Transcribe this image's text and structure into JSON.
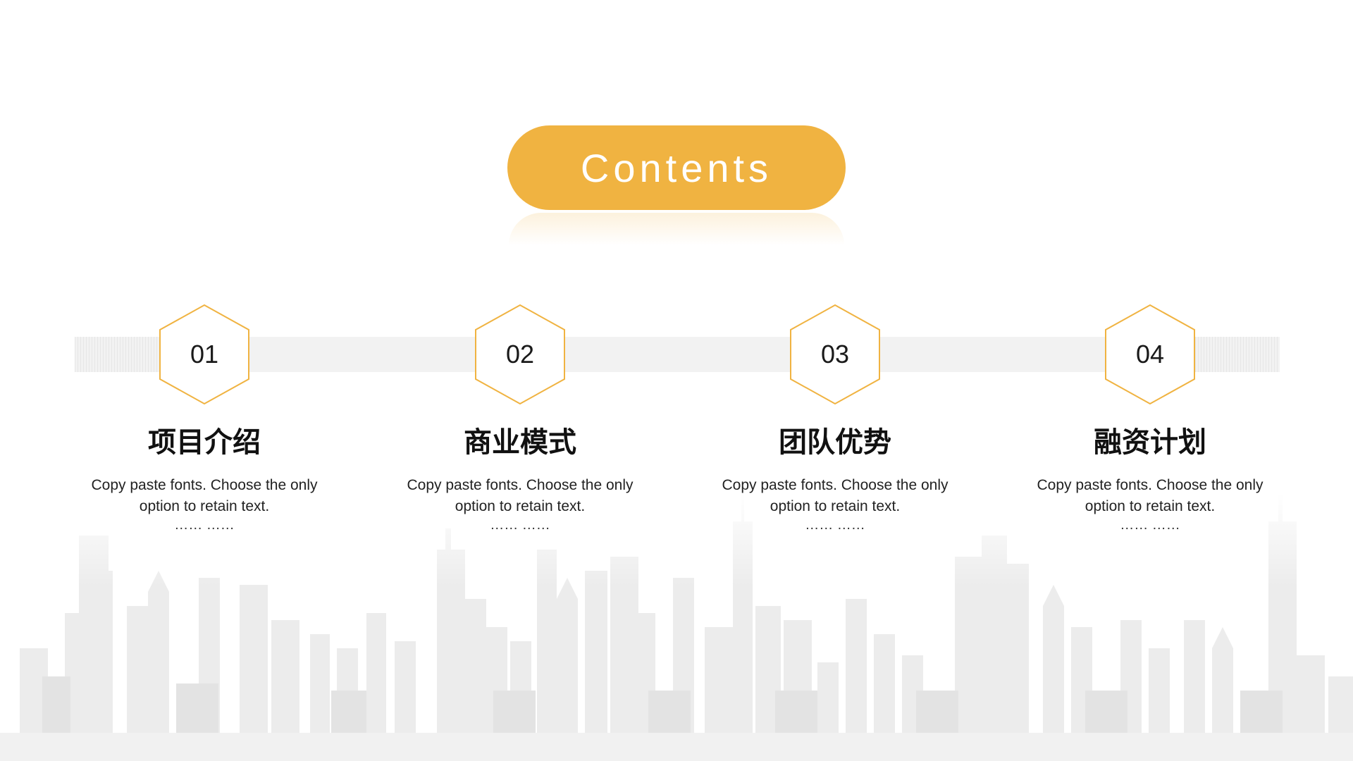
{
  "slide": {
    "title": "Contents",
    "accent_color": "#F0B341",
    "items": [
      {
        "number": "01",
        "title": "项目介绍",
        "desc_line1": "Copy paste fonts. Choose the only",
        "desc_line2": "option to retain text.",
        "more": "…… ……"
      },
      {
        "number": "02",
        "title": "商业模式",
        "desc_line1": "Copy paste fonts. Choose the only",
        "desc_line2": "option to retain text.",
        "more": "…… ……"
      },
      {
        "number": "03",
        "title": "团队优势",
        "desc_line1": "Copy paste fonts. Choose the only",
        "desc_line2": "option to retain text.",
        "more": "…… ……"
      },
      {
        "number": "04",
        "title": "融资计划",
        "desc_line1": "Copy paste fonts. Choose the only",
        "desc_line2": "option to retain text.",
        "more": "…… ……"
      }
    ],
    "decorations": {
      "background_icon": "city-skyline-icon",
      "item_icon": "hexagon-outline-icon"
    }
  }
}
